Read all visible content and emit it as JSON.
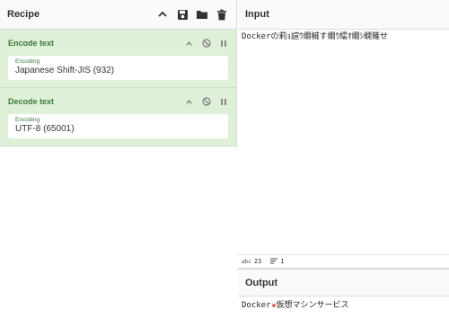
{
  "recipe": {
    "title": "Recipe",
    "icons": [
      "chevron-up-icon",
      "save-icon",
      "folder-icon",
      "trash-icon"
    ],
    "operations": [
      {
        "name": "Encode text",
        "arg_label": "Encoding",
        "arg_value": "Japanese Shift-JIS (932)"
      },
      {
        "name": "Decode text",
        "arg_label": "Encoding",
        "arg_value": "UTF-8 (65001)"
      }
    ]
  },
  "input": {
    "title": "Input",
    "text": "Dockerの莉ｮ諠ｳ繝槭す繝ｳ繧ｵ繝ｼ繝薙せ",
    "status": {
      "length_label": "abc",
      "length": "23",
      "lines": "1"
    }
  },
  "output": {
    "title": "Output",
    "text_before": "Docker",
    "text_after": "仮想マシンサービス"
  },
  "colors": {
    "op_bg": "#dff0d8",
    "op_text": "#3c763d",
    "accent_dot": "#e06666"
  }
}
